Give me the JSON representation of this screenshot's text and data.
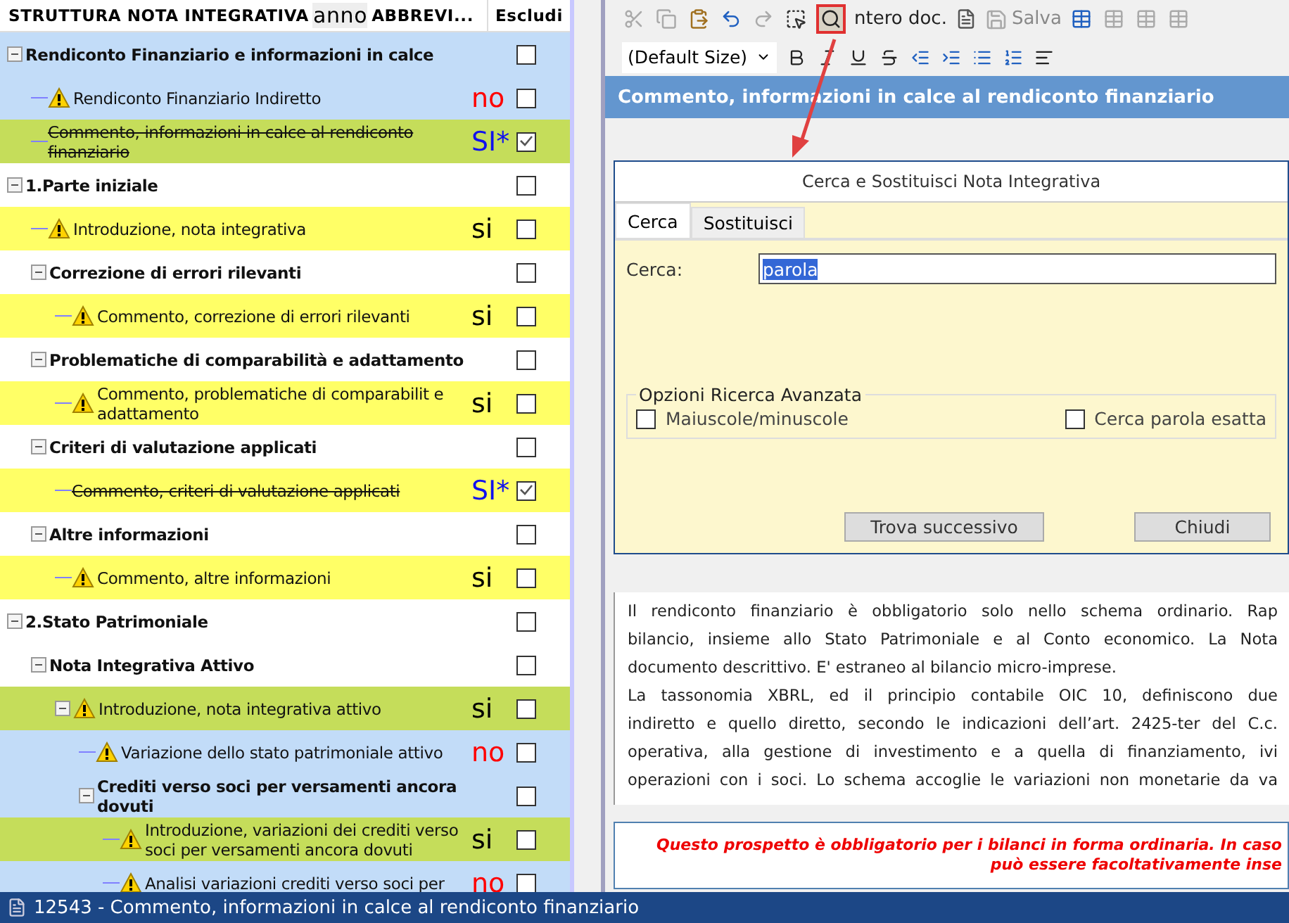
{
  "tree_header": {
    "title": "STRUTTURA NOTA INTEGRATIVA",
    "overlay": "anno",
    "abbrev": "ABBREVI...",
    "exclude": "Escludi"
  },
  "tree": [
    {
      "title": "Rendiconto Finanziario e informazioni in calce",
      "kind": "section",
      "color": "#c2dcf8",
      "expanded": true,
      "excluded": false,
      "children": [
        {
          "title": "Rendiconto Finanziario Indiretto",
          "kind": "item",
          "color": "#c2dcf8",
          "struck": false,
          "excluded": false,
          "badge": {
            "text": "no",
            "color": "#ff0000"
          }
        },
        {
          "title": "Commento, informazioni in calce al rendiconto finanziario",
          "kind": "note",
          "color": "#c5dd5a",
          "struck": true,
          "excluded": true,
          "badge": {
            "text": "SI*",
            "color": "#1010ee"
          }
        }
      ]
    },
    {
      "title": "1.Parte iniziale",
      "kind": "section",
      "color": "#ffffff",
      "expanded": true,
      "excluded": false,
      "children": [
        {
          "title": "Introduzione, nota integrativa",
          "kind": "item",
          "color": "#ffff66",
          "struck": false,
          "excluded": false,
          "badge": {
            "text": "si",
            "color": "#000000"
          }
        },
        {
          "title": "Correzione di errori rilevanti",
          "kind": "section",
          "color": "#ffffff",
          "expanded": true,
          "excluded": false,
          "children": [
            {
              "title": "Commento, correzione di errori rilevanti",
              "kind": "item",
              "color": "#ffff66",
              "struck": false,
              "excluded": false,
              "badge": {
                "text": "si",
                "color": "#000000"
              }
            }
          ]
        },
        {
          "title": "Problematiche di comparabilità e adattamento",
          "kind": "section",
          "color": "#ffffff",
          "expanded": true,
          "excluded": false,
          "children": [
            {
              "title": "Commento, problematiche di comparabilit e adattamento",
              "kind": "item",
              "color": "#ffff66",
              "struck": false,
              "excluded": false,
              "badge": {
                "text": "si",
                "color": "#000000"
              }
            }
          ]
        },
        {
          "title": "Criteri di valutazione applicati",
          "kind": "section",
          "color": "#ffffff",
          "expanded": true,
          "excluded": false,
          "children": [
            {
              "title": "Commento, criteri di valutazione applicati",
              "kind": "note",
              "color": "#ffff66",
              "struck": true,
              "excluded": true,
              "badge": {
                "text": "SI*",
                "color": "#1010ee"
              }
            }
          ]
        },
        {
          "title": "Altre informazioni",
          "kind": "section",
          "color": "#ffffff",
          "expanded": true,
          "excluded": false,
          "children": [
            {
              "title": "Commento, altre informazioni",
              "kind": "item",
              "color": "#ffff66",
              "struck": false,
              "excluded": false,
              "badge": {
                "text": "si",
                "color": "#000000"
              }
            }
          ]
        }
      ]
    },
    {
      "title": "2.Stato Patrimoniale",
      "kind": "section",
      "color": "#ffffff",
      "expanded": true,
      "excluded": false,
      "children": [
        {
          "title": "Nota Integrativa Attivo",
          "kind": "section",
          "color": "#ffffff",
          "expanded": true,
          "excluded": false,
          "children": [
            {
              "title": "Introduzione, nota integrativa attivo",
              "kind": "item",
              "color": "#c5dd5a",
              "struck": false,
              "excluded": false,
              "expanded": true,
              "badge": {
                "text": "si",
                "color": "#000000"
              },
              "children": [
                {
                  "title": "Variazione dello stato patrimoniale attivo",
                  "kind": "item",
                  "color": "#c2dcf8",
                  "struck": false,
                  "excluded": false,
                  "badge": {
                    "text": "no",
                    "color": "#ff0000"
                  }
                },
                {
                  "title": "Crediti verso soci per versamenti ancora dovuti",
                  "kind": "section",
                  "color": "#c2dcf8",
                  "expanded": true,
                  "excluded": false,
                  "children": [
                    {
                      "title": "Introduzione, variazioni dei crediti verso soci per versamenti ancora dovuti",
                      "kind": "item",
                      "color": "#c5dd5a",
                      "struck": false,
                      "excluded": false,
                      "badge": {
                        "text": "si",
                        "color": "#000000"
                      }
                    },
                    {
                      "title": "Analisi variazioni crediti verso soci per",
                      "kind": "item",
                      "color": "#c2dcf8",
                      "struck": false,
                      "excluded": false,
                      "badge": {
                        "text": "no",
                        "color": "#ff0000"
                      }
                    }
                  ]
                }
              ]
            }
          ]
        }
      ]
    }
  ],
  "toolbar": {
    "whole_doc": "ntero doc.",
    "save": "Salva",
    "save_disabled": true,
    "font_size": "(Default Size)"
  },
  "editor_title": "Commento, informazioni in calce al rendiconto finanziario",
  "dialog": {
    "title": "Cerca e Sostituisci Nota Integrativa",
    "tabs": [
      {
        "label": "Cerca",
        "selected": true
      },
      {
        "label": "Sostituisci",
        "selected": false
      }
    ],
    "search_label": "Cerca:",
    "search_value": "parola",
    "options_title": "Opzioni Ricerca Avanzata",
    "options": [
      {
        "label": "Maiuscole/minuscole",
        "checked": false
      },
      {
        "label": "Cerca parola esatta",
        "checked": false
      }
    ],
    "buttons": [
      "Trova successivo",
      "Chiudi"
    ]
  },
  "document_lines": [
    {
      "text": "Il rendiconto finanziario è obbligatorio  solo nello schema ordinario. Rap",
      "kind": "justified"
    },
    {
      "text": "bilancio, insieme allo Stato Patrimoniale e al Conto economico. La Nota",
      "kind": "justified"
    },
    {
      "text": "documento descrittivo. E' estraneo al bilancio micro-imprese.",
      "kind": "last"
    },
    {
      "text": "La tassonomia XBRL, ed il principio contabile OIC 10, definiscono due",
      "kind": "justified"
    },
    {
      "text": "indiretto e quello diretto, secondo le indicazioni dell’art. 2425-ter del C.c.",
      "kind": "justified"
    },
    {
      "text": "operativa, alla gestione di investimento e a quella di finanziamento, ivi",
      "kind": "justified"
    },
    {
      "text": "operazioni con i soci. Lo schema accoglie le variazioni non monetarie da va",
      "kind": "justified"
    }
  ],
  "notice_lines": [
    "Questo prospetto è obbligatorio per i bilanci in forma ordinaria. In caso",
    "può essere facoltativamente inse"
  ],
  "status_bar": "12543 - Commento, informazioni in calce al rendiconto finanziario"
}
